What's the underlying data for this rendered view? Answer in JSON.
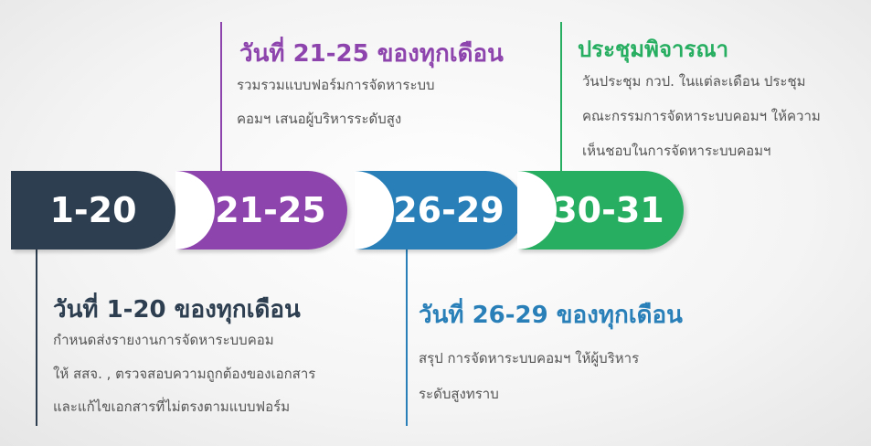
{
  "colors": {
    "dark": "#2c3e50",
    "purple": "#8e44ad",
    "blue": "#2980b9",
    "green": "#27ae60"
  },
  "segments": [
    {
      "label": "1-20"
    },
    {
      "label": "21-25"
    },
    {
      "label": "26-29"
    },
    {
      "label": "30-31"
    }
  ],
  "notes": {
    "n1": {
      "heading": "วันที่ 1-20 ของทุกเดือน",
      "lines": [
        "กำหนดส่งรายงานการจัดหาระบบคอม",
        "ให้ สสจ. , ตรวจสอบความถูกต้องของเอกสาร",
        "และแก้ไขเอกสารที่ไม่ตรงตามแบบฟอร์ม"
      ]
    },
    "n2": {
      "heading": "วันที่ 21-25 ของทุกเดือน",
      "lines": [
        "รวมรวมแบบฟอร์มการจัดหาระบบ",
        "คอมฯ เสนอผู้บริหารระดับสูง"
      ]
    },
    "n3": {
      "heading": "วันที่ 26-29 ของทุกเดือน",
      "lines": [
        "สรุป การจัดหาระบบคอมฯ ให้ผู้บริหาร",
        "ระดับสูงทราบ"
      ]
    },
    "n4": {
      "heading": "ประชุมพิจารณา",
      "lines": [
        "วันประชุม กวป. ในแต่ละเดือน ประชุม",
        "คณะกรรมการจัดหาระบบคอมฯ ให้ความ",
        "เห็นชอบในการจัดหาระบบคอมฯ"
      ]
    }
  }
}
